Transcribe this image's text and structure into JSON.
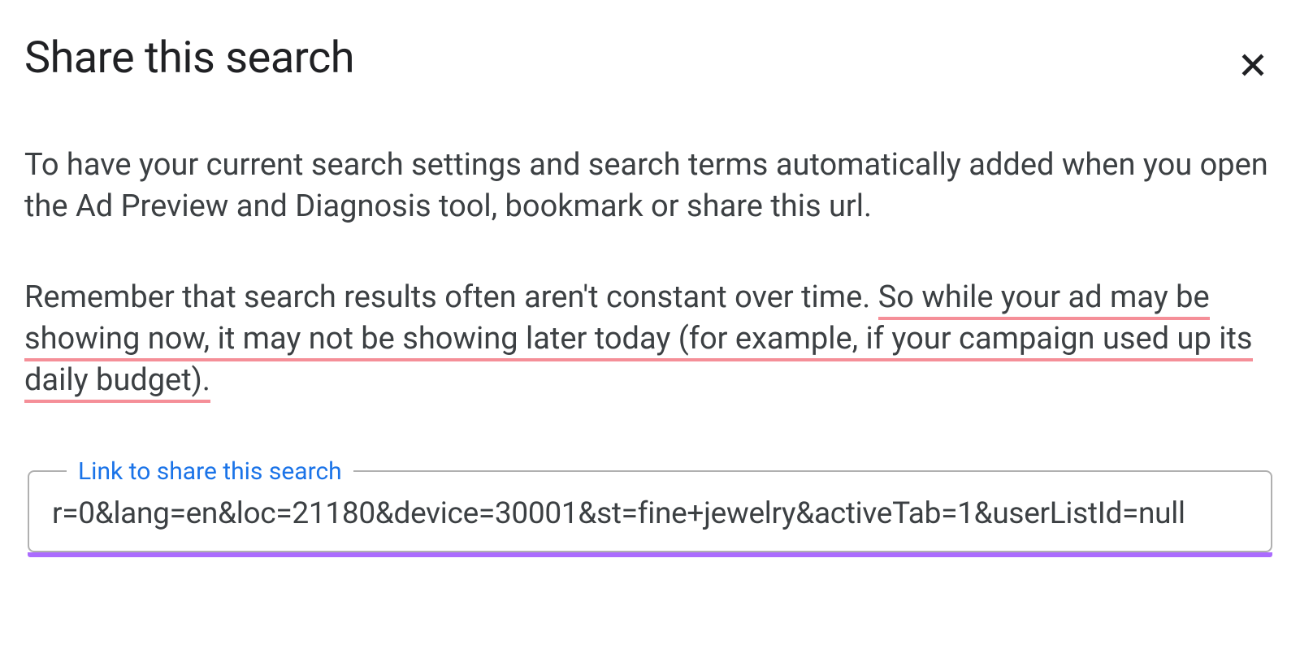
{
  "dialog": {
    "title": "Share this search"
  },
  "paragraph1": "To have your current search settings and search terms automatically added when you open the Ad Preview and Diagnosis tool, bookmark or share this url.",
  "paragraph2": {
    "plain": "Remember that search results often aren't constant over time. ",
    "highlighted": "So while your ad may be showing now, it may not be showing later today (for example, if your campaign used up its daily budget)."
  },
  "link_field": {
    "legend": "Link to share this search",
    "value": "r=0&lang=en&loc=21180&device=30001&st=fine+jewelry&activeTab=1&userListId=null"
  }
}
